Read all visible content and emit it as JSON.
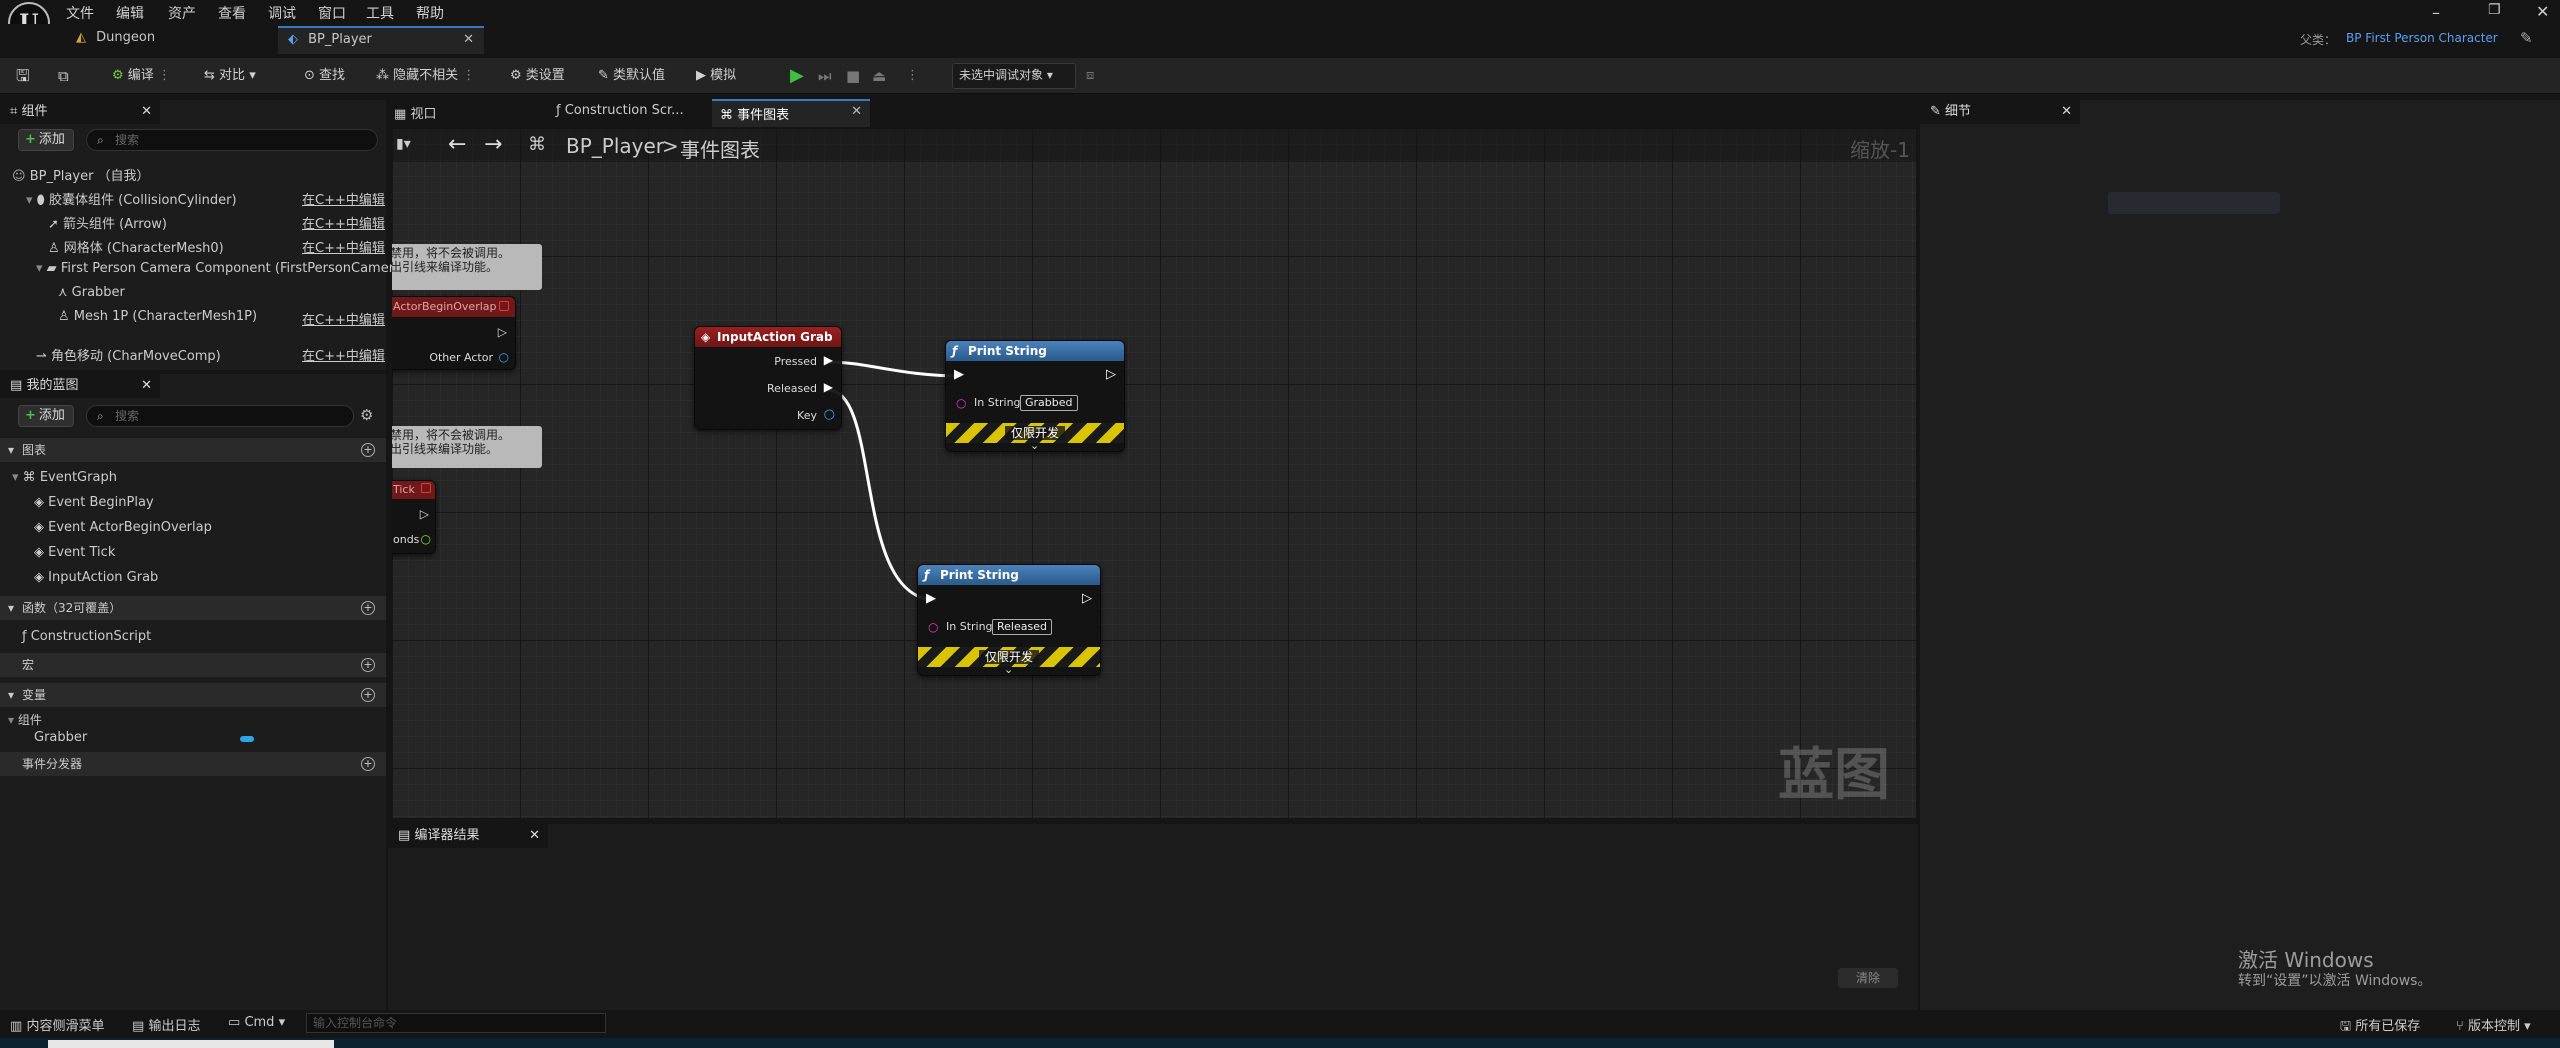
{
  "menubar": {
    "items": [
      "文件",
      "编辑",
      "资产",
      "查看",
      "调试",
      "窗口",
      "工具",
      "帮助"
    ],
    "parent_label": "父类：",
    "parent_value": "BP First Person Character"
  },
  "tabs": [
    {
      "label": "Dungeon"
    },
    {
      "label": "BP_Player"
    }
  ],
  "toolbar": {
    "compile": "编译",
    "diff": "对比",
    "find": "查找",
    "hide_unrelated": "隐藏不相关",
    "class_settings": "类设置",
    "class_defaults": "类默认值",
    "simulate": "模拟",
    "debug_target": "未选中调试对象"
  },
  "components_panel": {
    "title": "组件",
    "add": "添加",
    "search_placeholder": "搜索",
    "root": "BP_Player （自我）",
    "edit_in_cpp": "在C++中编辑",
    "items": [
      "胶囊体组件 (CollisionCylinder)",
      "箭头组件 (Arrow)",
      "网格体 (CharacterMesh0)",
      "First Person Camera Component (FirstPersonCamera)",
      "Grabber",
      "Mesh 1P (CharacterMesh1P)",
      "角色移动 (CharMoveComp)"
    ]
  },
  "blueprint_panel": {
    "title": "我的蓝图",
    "add": "添加",
    "search_placeholder": "搜索",
    "graphs_section": "图表",
    "event_graph": "EventGraph",
    "events": [
      "Event BeginPlay",
      "Event ActorBeginOverlap",
      "Event Tick",
      "InputAction Grab"
    ],
    "functions_section": "函数（32可覆盖）",
    "construction_script": "ConstructionScript",
    "macros_section": "宏",
    "variables_section": "变量",
    "components_category": "组件",
    "grabber_var": "Grabber",
    "dispatchers_section": "事件分发器"
  },
  "graph_tabs": {
    "viewport": "视口",
    "construction": "Construction Scr...",
    "event_graph": "事件图表"
  },
  "graph": {
    "breadcrumb_root": "BP_Player",
    "breadcrumb_sep": ">",
    "breadcrumb_leaf": "事件图表",
    "zoom": "缩放-1",
    "watermark": "蓝图",
    "comment_text": "禁用，将不会被调用。\n出引线来编译功能。",
    "partial_labels": {
      "overlap": "ActorBeginOverlap",
      "other_actor": "Other Actor",
      "tick": "Tick",
      "seconds": "onds"
    },
    "input_node": {
      "title": "InputAction Grab",
      "pins": [
        "Pressed",
        "Released",
        "Key"
      ]
    },
    "print_nodes": [
      {
        "title": "Print String",
        "in_label": "In String",
        "value": "Grabbed",
        "dev_only": "仅限开发"
      },
      {
        "title": "Print String",
        "in_label": "In String",
        "value": "Released",
        "dev_only": "仅限开发"
      }
    ]
  },
  "details_panel": {
    "title": "细节"
  },
  "compiler_panel": {
    "title": "编译器结果",
    "clear": "清除"
  },
  "watermark_windows": {
    "line1": "激活 Windows",
    "line2": "转到“设置”以激活 Windows。"
  },
  "bottombar": {
    "content_drawer": "内容侧滑菜单",
    "output_log": "输出日志",
    "cmd": "Cmd",
    "cmd_placeholder": "输入控制台命令",
    "saved": "所有已保存",
    "source_control": "版本控制"
  },
  "colors": {
    "accent": "#3a79c9",
    "event_red": "#8b1d1d",
    "function_blue": "#3a6ea5",
    "hatch_yellow": "#d8c400",
    "exec_wire": "#ffffff"
  }
}
